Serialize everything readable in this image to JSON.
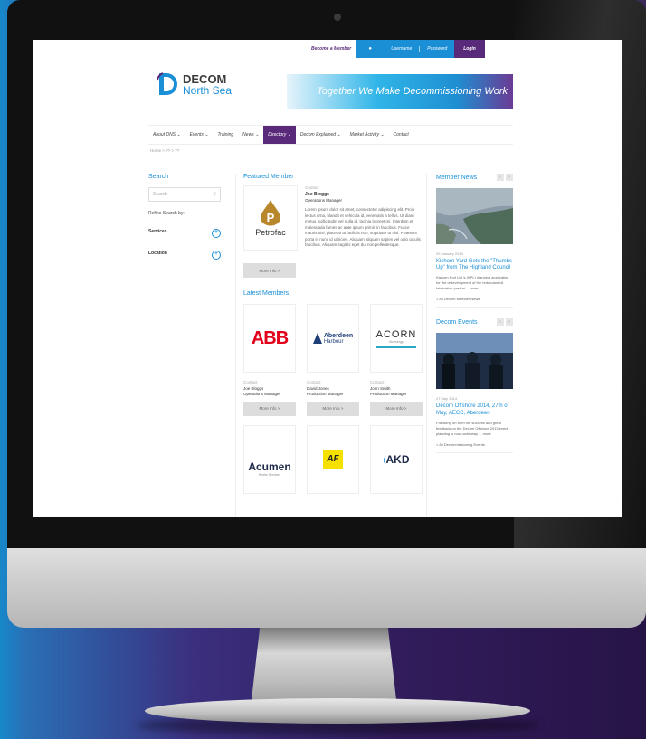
{
  "topbar": {
    "become_member": "Become a Member",
    "username": "Username",
    "password": "Password",
    "login": "Login"
  },
  "logo": {
    "line1": "DECOM",
    "line2": "North Sea"
  },
  "banner": {
    "tagline": "Together We Make Decommissioning Work"
  },
  "nav": {
    "items": [
      "About DNS ⌄",
      "Events ⌄",
      "Training",
      "News ⌄",
      "Directory ⌄",
      "Decom Explained ⌄",
      "Market Activity ⌄",
      "Contact"
    ],
    "active_index": 4
  },
  "breadcrumb": "Home  >  ??  >  ??",
  "search": {
    "title": "Search",
    "placeholder": "Search",
    "refine": "Refine Search by:",
    "filters": [
      "Services",
      "Location"
    ]
  },
  "featured": {
    "title": "Featured Member",
    "company": "Petrofac",
    "label": "Contact",
    "name": "Joe Bloggs",
    "role": "Operations Manager",
    "text": "Lorem ipsum dolor sit amet, consectetur adipiscing elit. Proin lectus urna, blandit et vehicula id, venenatis a tellus. Ut diam metus, sollicitudin vel nulla id, lacinia laoreet mi. Interdum et malesuada fames ac ante ipsum primis in faucibus. Fusce mauris nisl, placerat at facilisis non, vulputate ut nisl. Praesent porta in nunc id ultricies. Aliquam aliquam sapien vel odio iaculis faucibus. Aliquam sagittis eget dui non pellentesque.",
    "more": "More Info  >"
  },
  "latest": {
    "title": "Latest Members",
    "members": [
      {
        "company": "ABB",
        "label": "Contact",
        "name": "Joe Bloggs",
        "role": "Operations Manager",
        "more": "More Info  >"
      },
      {
        "company": "Aberdeen",
        "sub": "Harbour",
        "label": "Contact",
        "name": "David Jones",
        "role": "Production Manager",
        "more": "More Info  >"
      },
      {
        "company": "ACORN",
        "sub": "bioenergy",
        "label": "Contact",
        "name": "John Smith",
        "role": "Production Manager",
        "more": "More Info  >"
      }
    ],
    "row2": [
      {
        "company": "Acumen",
        "sub": "Works Services"
      },
      {
        "company": "AF"
      },
      {
        "company": "AKD"
      }
    ]
  },
  "news": {
    "title": "Member News",
    "prev": "‹",
    "next": "›",
    "date": "29 January 2014",
    "headline": "Kishorn Yard Gets the \"Thumbs Up\" from The Highland Council",
    "text": "Kishorn Port Ltd.'s (KPL) planning application for the redevelopment of the redundant oil fabrication yard at ... more",
    "link": ">   All Decom Member News"
  },
  "events": {
    "title": "Decom Events",
    "prev": "‹",
    "next": "›",
    "date": "27 May 2014",
    "headline": "Decom Offshore 2014, 27th of May, AECC, Aberdeen",
    "text": "Following on from the success and great feedback on the Decom Offshore 2013 event planning is now underway ... more",
    "link": ">   All Decommissioning Events"
  },
  "colors": {
    "purple": "#5a2a7a",
    "blue": "#1a8fd6",
    "abb_red": "#e2001a",
    "af_yellow": "#f5e000"
  }
}
